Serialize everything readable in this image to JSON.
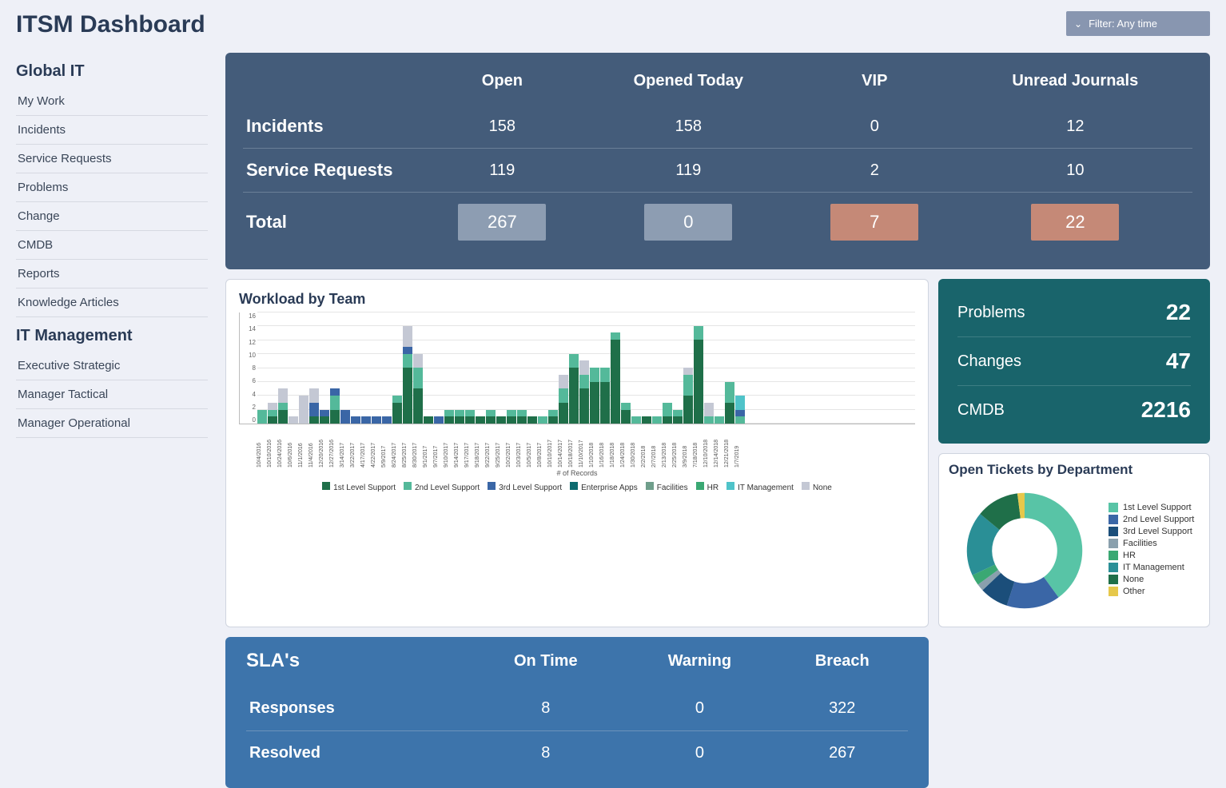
{
  "page_title": "ITSM Dashboard",
  "filter": {
    "label": "Filter: Any time"
  },
  "sidebar": {
    "sections": [
      {
        "heading": "Global IT",
        "items": [
          "My Work",
          "Incidents",
          "Service Requests",
          "Problems",
          "Change",
          "CMDB",
          "Reports",
          "Knowledge Articles"
        ]
      },
      {
        "heading": "IT Management",
        "items": [
          "Executive Strategic",
          "Manager Tactical",
          "Manager Operational"
        ]
      }
    ]
  },
  "summary": {
    "headers": [
      "Open",
      "Opened Today",
      "VIP",
      "Unread Journals"
    ],
    "rows": [
      {
        "label": "Incidents",
        "values": [
          "158",
          "158",
          "0",
          "12"
        ]
      },
      {
        "label": "Service Requests",
        "values": [
          "119",
          "119",
          "2",
          "10"
        ]
      }
    ],
    "total_label": "Total",
    "totals": [
      {
        "value": "267",
        "style": "grey"
      },
      {
        "value": "0",
        "style": "grey"
      },
      {
        "value": "7",
        "style": "orange"
      },
      {
        "value": "22",
        "style": "orange"
      }
    ]
  },
  "kpis": [
    {
      "label": "Problems",
      "value": "22"
    },
    {
      "label": "Changes",
      "value": "47"
    },
    {
      "label": "CMDB",
      "value": "2216"
    }
  ],
  "sla": {
    "title": "SLA's",
    "headers": [
      "On Time",
      "Warning",
      "Breach"
    ],
    "rows": [
      {
        "label": "Responses",
        "values": [
          "8",
          "0",
          "322"
        ]
      },
      {
        "label": "Resolved",
        "values": [
          "8",
          "0",
          "267"
        ]
      }
    ]
  },
  "workload": {
    "title": "Workload by Team",
    "xaxis_title": "# of Records",
    "legend": [
      {
        "name": "1st Level Support",
        "color": "#1f6f49"
      },
      {
        "name": "2nd Level Support",
        "color": "#54b99a"
      },
      {
        "name": "3rd Level Support",
        "color": "#3a66a6"
      },
      {
        "name": "Enterprise Apps",
        "color": "#0d6b6f"
      },
      {
        "name": "Facilities",
        "color": "#6f9e8b"
      },
      {
        "name": "HR",
        "color": "#3aa873"
      },
      {
        "name": "IT Management",
        "color": "#4fc3c9"
      },
      {
        "name": "None",
        "color": "#c4c8d4"
      }
    ]
  },
  "open_tickets": {
    "title": "Open Tickets by Department",
    "legend": [
      {
        "name": "1st Level Support",
        "color": "#58c4a6"
      },
      {
        "name": "2nd Level Support",
        "color": "#3a66a6"
      },
      {
        "name": "3rd Level Support",
        "color": "#1b4e7a"
      },
      {
        "name": "Facilities",
        "color": "#8aa0ad"
      },
      {
        "name": "HR",
        "color": "#3aa873"
      },
      {
        "name": "IT Management",
        "color": "#2a8f96"
      },
      {
        "name": "None",
        "color": "#1f6f49"
      },
      {
        "name": "Other",
        "color": "#e6c84b"
      }
    ]
  },
  "chart_data": [
    {
      "id": "workload_by_team",
      "type": "bar",
      "stacked": true,
      "title": "Workload by Team",
      "xlabel": "# of Records",
      "ylabel": "",
      "ylim": [
        0,
        16
      ],
      "yticks": [
        0,
        2,
        4,
        6,
        8,
        10,
        12,
        14,
        16
      ],
      "categories": [
        "10/4/2016",
        "10/10/2016",
        "10/24/2016",
        "10/6/2016",
        "11/1/2016",
        "11/4/2016",
        "12/20/2016",
        "12/27/2016",
        "3/14/2017",
        "3/22/2017",
        "4/17/2017",
        "4/22/2017",
        "5/9/2017",
        "8/24/2017",
        "8/25/2017",
        "8/30/2017",
        "9/1/2017",
        "9/7/2017",
        "9/10/2017",
        "9/14/2017",
        "9/17/2017",
        "9/18/2017",
        "9/22/2017",
        "9/25/2017",
        "10/2/2017",
        "10/3/2017",
        "10/5/2017",
        "10/8/2017",
        "10/10/2017",
        "10/14/2017",
        "10/18/2017",
        "11/10/2017",
        "1/10/2018",
        "1/16/2018",
        "1/18/2018",
        "1/24/2018",
        "1/30/2018",
        "2/2/2018",
        "2/7/2018",
        "2/13/2018",
        "2/25/2018",
        "3/9/2018",
        "7/18/2018",
        "12/10/2018",
        "12/14/2018",
        "12/21/2018",
        "1/7/2019"
      ],
      "series": [
        {
          "name": "1st Level Support",
          "color": "#1f6f49",
          "values": [
            0,
            1,
            2,
            0,
            0,
            1,
            1,
            2,
            0,
            0,
            0,
            0,
            0,
            3,
            8,
            5,
            1,
            0,
            1,
            1,
            1,
            1,
            1,
            1,
            1,
            1,
            1,
            0,
            1,
            3,
            8,
            5,
            6,
            6,
            12,
            2,
            0,
            1,
            0,
            1,
            1,
            4,
            12,
            0,
            0,
            3,
            0
          ]
        },
        {
          "name": "2nd Level Support",
          "color": "#54b99a",
          "values": [
            2,
            1,
            1,
            0,
            0,
            0,
            0,
            2,
            0,
            0,
            0,
            0,
            0,
            1,
            2,
            3,
            0,
            0,
            1,
            1,
            1,
            0,
            1,
            0,
            1,
            1,
            0,
            1,
            1,
            2,
            2,
            2,
            2,
            2,
            1,
            1,
            1,
            0,
            1,
            2,
            1,
            3,
            2,
            1,
            1,
            3,
            1
          ]
        },
        {
          "name": "3rd Level Support",
          "color": "#3a66a6",
          "values": [
            0,
            0,
            0,
            0,
            0,
            2,
            1,
            1,
            2,
            1,
            1,
            1,
            1,
            0,
            1,
            0,
            0,
            1,
            0,
            0,
            0,
            0,
            0,
            0,
            0,
            0,
            0,
            0,
            0,
            0,
            0,
            0,
            0,
            0,
            0,
            0,
            0,
            0,
            0,
            0,
            0,
            0,
            0,
            0,
            0,
            0,
            1
          ]
        },
        {
          "name": "Enterprise Apps",
          "color": "#0d6b6f",
          "values": [
            0,
            0,
            0,
            0,
            0,
            0,
            0,
            0,
            0,
            0,
            0,
            0,
            0,
            0,
            0,
            0,
            0,
            0,
            0,
            0,
            0,
            0,
            0,
            0,
            0,
            0,
            0,
            0,
            0,
            0,
            0,
            0,
            0,
            0,
            0,
            0,
            0,
            0,
            0,
            0,
            0,
            0,
            0,
            0,
            0,
            0,
            0
          ]
        },
        {
          "name": "Facilities",
          "color": "#6f9e8b",
          "values": [
            0,
            0,
            0,
            0,
            0,
            0,
            0,
            0,
            0,
            0,
            0,
            0,
            0,
            0,
            0,
            0,
            0,
            0,
            0,
            0,
            0,
            0,
            0,
            0,
            0,
            0,
            0,
            0,
            0,
            0,
            0,
            0,
            0,
            0,
            0,
            0,
            0,
            0,
            0,
            0,
            0,
            0,
            0,
            0,
            0,
            0,
            0
          ]
        },
        {
          "name": "HR",
          "color": "#3aa873",
          "values": [
            0,
            0,
            0,
            0,
            0,
            0,
            0,
            0,
            0,
            0,
            0,
            0,
            0,
            0,
            0,
            0,
            0,
            0,
            0,
            0,
            0,
            0,
            0,
            0,
            0,
            0,
            0,
            0,
            0,
            0,
            0,
            0,
            0,
            0,
            0,
            0,
            0,
            0,
            0,
            0,
            0,
            0,
            0,
            0,
            0,
            0,
            0
          ]
        },
        {
          "name": "IT Management",
          "color": "#4fc3c9",
          "values": [
            0,
            0,
            0,
            0,
            0,
            0,
            0,
            0,
            0,
            0,
            0,
            0,
            0,
            0,
            0,
            0,
            0,
            0,
            0,
            0,
            0,
            0,
            0,
            0,
            0,
            0,
            0,
            0,
            0,
            0,
            0,
            0,
            0,
            0,
            0,
            0,
            0,
            0,
            0,
            0,
            0,
            0,
            0,
            0,
            0,
            0,
            2
          ]
        },
        {
          "name": "None",
          "color": "#c4c8d4",
          "values": [
            0,
            1,
            2,
            1,
            4,
            2,
            0,
            0,
            0,
            0,
            0,
            0,
            0,
            0,
            3,
            2,
            0,
            0,
            0,
            0,
            0,
            0,
            0,
            0,
            0,
            0,
            0,
            0,
            0,
            2,
            0,
            2,
            0,
            0,
            0,
            0,
            0,
            0,
            0,
            0,
            0,
            1,
            0,
            2,
            0,
            0,
            0
          ]
        }
      ]
    },
    {
      "id": "open_tickets_by_department",
      "type": "pie",
      "title": "Open Tickets by Department",
      "donut": true,
      "series": [
        {
          "name": "1st Level Support",
          "color": "#58c4a6",
          "value": 40
        },
        {
          "name": "2nd Level Support",
          "color": "#3a66a6",
          "value": 15
        },
        {
          "name": "3rd Level Support",
          "color": "#1b4e7a",
          "value": 8
        },
        {
          "name": "Facilities",
          "color": "#8aa0ad",
          "value": 2
        },
        {
          "name": "HR",
          "color": "#3aa873",
          "value": 3
        },
        {
          "name": "IT Management",
          "color": "#2a8f96",
          "value": 18
        },
        {
          "name": "None",
          "color": "#1f6f49",
          "value": 12
        },
        {
          "name": "Other",
          "color": "#e6c84b",
          "value": 2
        }
      ]
    }
  ]
}
